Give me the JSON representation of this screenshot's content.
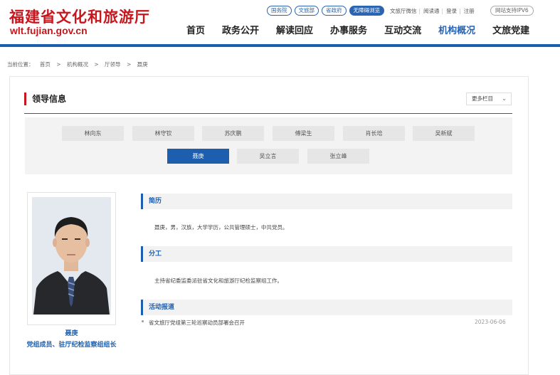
{
  "header": {
    "site_title": "福建省文化和旅游厅",
    "site_url": "wlt.fujian.gov.cn",
    "top_pills": [
      "国务院",
      "文旅部",
      "省政府",
      "无障碍浏览"
    ],
    "top_links": [
      "文旅厅微信",
      "阅读通",
      "登录",
      "注册"
    ],
    "ipv6": "网站支持IPV6",
    "nav": [
      "首页",
      "政务公开",
      "解读回应",
      "办事服务",
      "互动交流",
      "机构概况",
      "文旅党建"
    ]
  },
  "breadcrumb": {
    "label": "当前位置：",
    "items": [
      "首页",
      ">",
      "机构概况",
      ">",
      "厅领导",
      ">",
      "聂庚"
    ]
  },
  "section": {
    "title": "领导信息",
    "more_label": "更多栏目"
  },
  "leaders": [
    "林向东",
    "林守钦",
    "苏庆鹏",
    "傅梁生",
    "肖长培",
    "吴新斌",
    "聂庚",
    "吴立言",
    "张立峰"
  ],
  "profile": {
    "name": "聂庚",
    "role": "党组成员、驻厅纪检监察组组长",
    "resume_heading": "简历",
    "resume_text": "聂庚，男，汉族，大学学历，公共管理硕士，中共党员。",
    "duty_heading": "分工",
    "duty_text": "主持省纪委监委派驻省文化和旅游厅纪检监察组工作。",
    "news_heading": "活动报道",
    "news": [
      {
        "title": "省文旅厅党组第三轮巡察动员部署会召开",
        "date": "2023-06-06"
      }
    ]
  },
  "colors": {
    "brand_red": "#c8161d",
    "brand_blue": "#1d5fae"
  }
}
